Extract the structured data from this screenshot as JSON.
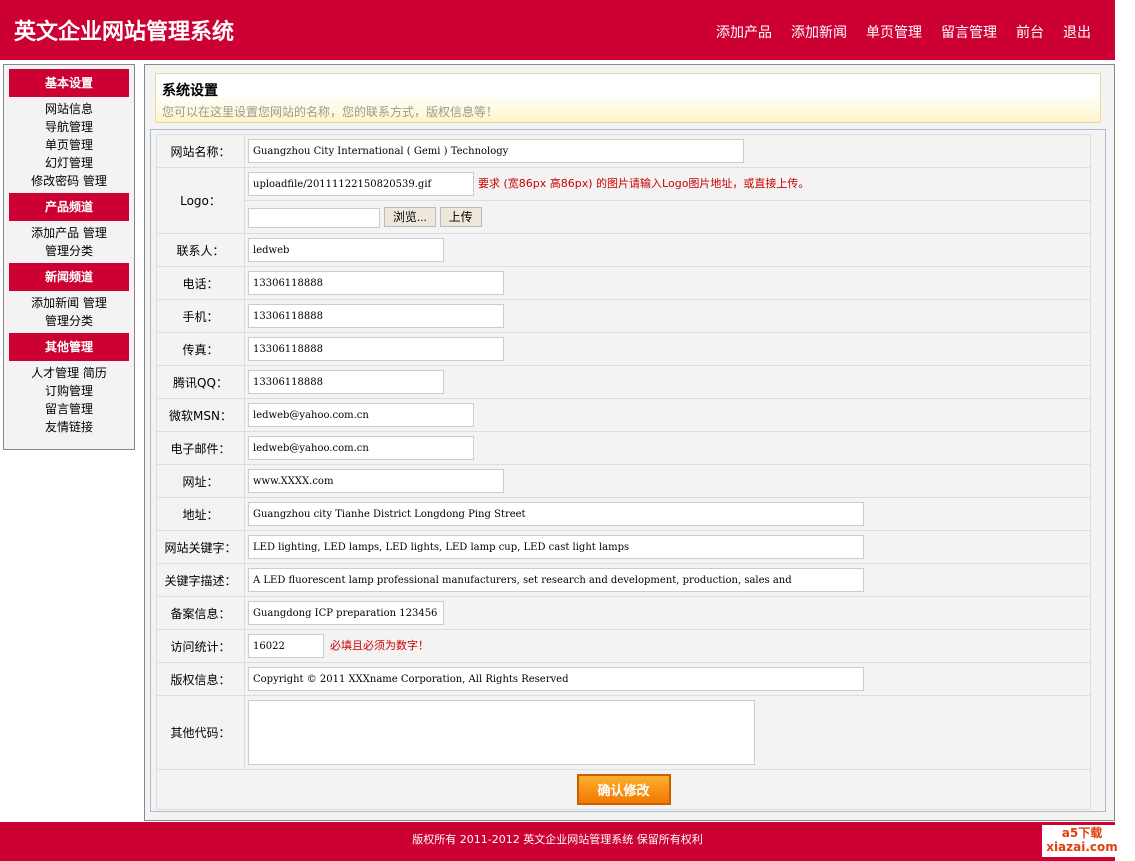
{
  "header": {
    "title": "英文企业网站管理系统",
    "nav": [
      "添加产品",
      "添加新闻",
      "单页管理",
      "留言管理",
      "前台",
      "退出"
    ]
  },
  "sidebar": [
    {
      "title": "基本设置",
      "items": [
        "网站信息",
        "导航管理",
        "单页管理",
        "幻灯管理",
        "修改密码 管理"
      ]
    },
    {
      "title": "产品频道",
      "items": [
        "添加产品 管理",
        "管理分类"
      ]
    },
    {
      "title": "新闻频道",
      "items": [
        "添加新闻 管理",
        "管理分类"
      ]
    },
    {
      "title": "其他管理",
      "items": [
        "人才管理 简历",
        "订购管理",
        "留言管理",
        "友情链接"
      ]
    }
  ],
  "notice": {
    "title": "系统设置",
    "desc": "您可以在这里设置您网站的名称，您的联系方式，版权信息等！"
  },
  "form": {
    "site_name": {
      "label": "网站名称：",
      "value": "Guangzhou City International ( Gemi ) Technology"
    },
    "logo": {
      "label": "Logo：",
      "value": "uploadfile/20111122150820539.gif",
      "hint": "要求 (宽86px 高86px) 的图片请输入Logo图片地址，或直接上传。",
      "browse": "浏览...",
      "upload": "上传"
    },
    "contact": {
      "label": "联系人：",
      "value": "ledweb"
    },
    "phone": {
      "label": "电话：",
      "value": "13306118888"
    },
    "mobile": {
      "label": "手机：",
      "value": "13306118888"
    },
    "fax": {
      "label": "传真：",
      "value": "13306118888"
    },
    "qq": {
      "label": "腾讯QQ：",
      "value": "13306118888"
    },
    "msn": {
      "label": "微软MSN：",
      "value": "ledweb@yahoo.com.cn"
    },
    "email": {
      "label": "电子邮件：",
      "value": "ledweb@yahoo.com.cn"
    },
    "url": {
      "label": "网址：",
      "value": "www.XXXX.com"
    },
    "address": {
      "label": "地址：",
      "value": "Guangzhou city Tianhe District Longdong Ping Street"
    },
    "keywords": {
      "label": "网站关键字：",
      "value": "LED lighting, LED lamps, LED lights, LED lamp cup, LED cast light lamps"
    },
    "description": {
      "label": "关键字描述：",
      "value": "A LED fluorescent lamp professional manufacturers, set research and development, production, sales and"
    },
    "icp": {
      "label": "备案信息：",
      "value": "Guangdong ICP preparation 123456"
    },
    "stats": {
      "label": "访问统计：",
      "value": "16022",
      "hint": "必填且必须为数字！"
    },
    "copyright": {
      "label": "版权信息：",
      "value": "Copyright © 2011 XXXname Corporation, All Rights Reserved"
    },
    "other": {
      "label": "其他代码：",
      "value": ""
    },
    "submit": "确认修改"
  },
  "footer": {
    "text": "版权所有 2011-2012 英文企业网站管理系统 保留所有权利",
    "badge": "a5下载 xiazai.com"
  }
}
